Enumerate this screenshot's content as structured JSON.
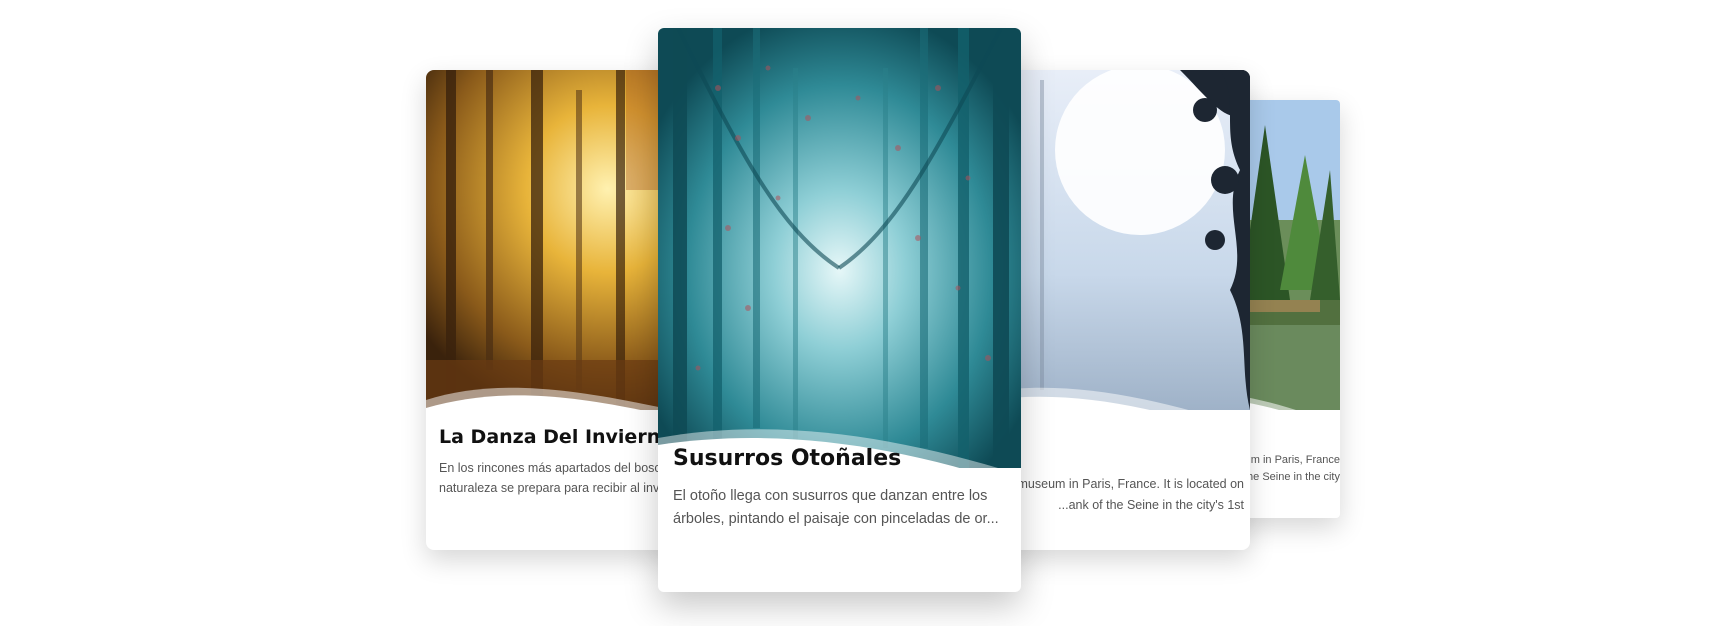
{
  "carousel": {
    "cards": [
      {
        "title": "La Danza Del Invierno",
        "text": "En los rincones más apartados del bosque, la naturaleza se prepara para recibir al invierno",
        "text_line1": "En los rincones más apartados del bosc",
        "text_line2": "naturaleza se prepara para recibir al inv",
        "image": "autumn-golden-forest",
        "colors": {
          "sky": "#f3d27a",
          "mid": "#c99a2e",
          "dark": "#4a2e12",
          "accent": "#e8a83a"
        }
      },
      {
        "title": "Susurros Otoñales",
        "text": "El otoño llega con susurros que danzan entre los árboles, pintando el paisaje con pinceladas de or...",
        "image": "teal-misty-forest",
        "colors": {
          "sky": "#cfeef0",
          "mid": "#3a9aa5",
          "dark": "#0e4a55",
          "accent": "#b0505a"
        }
      },
      {
        "title": "",
        "text_line1": "museum in Paris, France. It is located on",
        "text_line2": "ank of the Seine in the city's 1st...",
        "image": "misty-moon-forest",
        "colors": {
          "sky": "#eef4fb",
          "mid": "#c5d6ea",
          "dark": "#1d2632",
          "accent": "#ffffff"
        }
      },
      {
        "title": "",
        "text_line1": "um in Paris, France.",
        "text_line2": "the Seine in the city",
        "image": "lake-pine-forest",
        "colors": {
          "sky": "#9fc3e8",
          "mid": "#3f7a3a",
          "dark": "#24401f",
          "accent": "#c98a3a"
        }
      }
    ]
  }
}
